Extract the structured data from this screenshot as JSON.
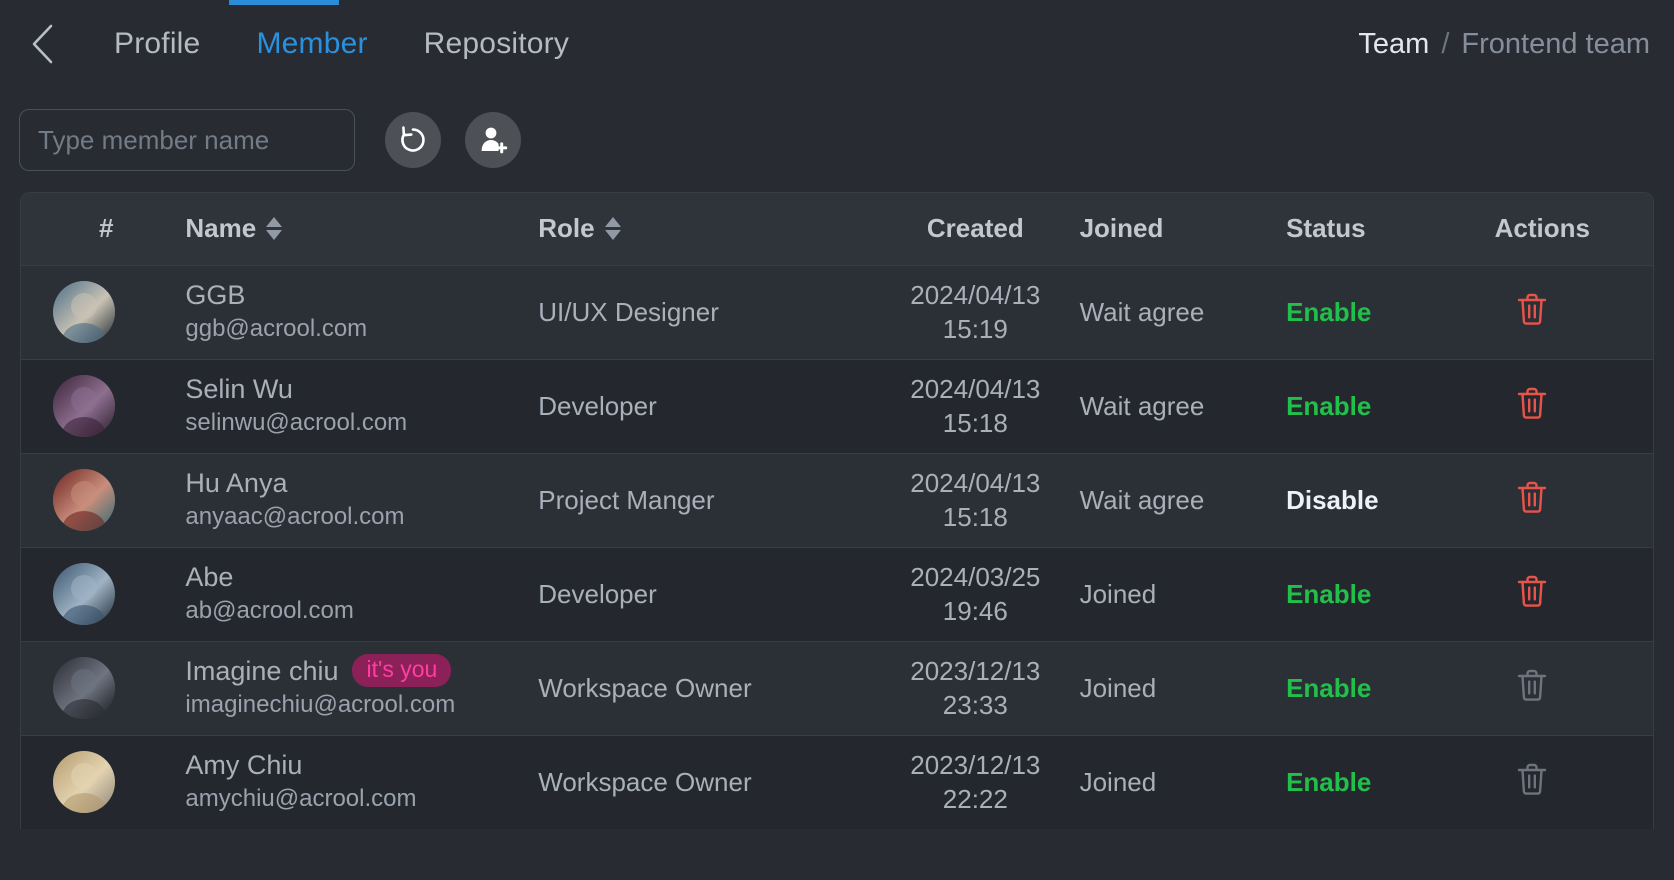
{
  "topbar": {
    "back_icon": "chevron-left-icon",
    "tabs": [
      {
        "label": "Profile",
        "active": false
      },
      {
        "label": "Member",
        "active": true
      },
      {
        "label": "Repository",
        "active": false
      }
    ],
    "breadcrumb": {
      "root": "Team",
      "separator": "/",
      "leaf": "Frontend team"
    }
  },
  "toolbar": {
    "search": {
      "value": "",
      "placeholder": "Type member name",
      "icon": "search-input"
    },
    "refresh_button": {
      "icon": "refresh-icon",
      "label": "Refresh"
    },
    "add_member_button": {
      "icon": "add-user-icon",
      "label": "Add member"
    }
  },
  "table": {
    "columns": [
      {
        "key": "index",
        "label": "#",
        "sortable": false
      },
      {
        "key": "name",
        "label": "Name",
        "sortable": true
      },
      {
        "key": "role",
        "label": "Role",
        "sortable": true
      },
      {
        "key": "created",
        "label": "Created",
        "sortable": false
      },
      {
        "key": "joined",
        "label": "Joined",
        "sortable": false
      },
      {
        "key": "status",
        "label": "Status",
        "sortable": false
      },
      {
        "key": "actions",
        "label": "Actions",
        "sortable": false
      }
    ],
    "rows": [
      {
        "name": "GGB",
        "email": "ggb@acrool.com",
        "badge": "",
        "role": "UI/UX Designer",
        "created_date": "2024/04/13",
        "created_time": "15:19",
        "joined": "Wait agree",
        "status": "Enable",
        "status_kind": "enable",
        "delete_enabled": true
      },
      {
        "name": "Selin Wu",
        "email": "selinwu@acrool.com",
        "badge": "",
        "role": "Developer",
        "created_date": "2024/04/13",
        "created_time": "15:18",
        "joined": "Wait agree",
        "status": "Enable",
        "status_kind": "enable",
        "delete_enabled": true
      },
      {
        "name": "Hu Anya",
        "email": "anyaac@acrool.com",
        "badge": "",
        "role": "Project Manger",
        "created_date": "2024/04/13",
        "created_time": "15:18",
        "joined": "Wait agree",
        "status": "Disable",
        "status_kind": "disable",
        "delete_enabled": true
      },
      {
        "name": "Abe",
        "email": "ab@acrool.com",
        "badge": "",
        "role": "Developer",
        "created_date": "2024/03/25",
        "created_time": "19:46",
        "joined": "Joined",
        "status": "Enable",
        "status_kind": "enable",
        "delete_enabled": true
      },
      {
        "name": "Imagine chiu",
        "email": "imaginechiu@acrool.com",
        "badge": "it's you",
        "role": "Workspace Owner",
        "created_date": "2023/12/13",
        "created_time": "23:33",
        "joined": "Joined",
        "status": "Enable",
        "status_kind": "enable",
        "delete_enabled": false
      },
      {
        "name": "Amy Chiu",
        "email": "amychiu@acrool.com",
        "badge": "",
        "role": "Workspace Owner",
        "created_date": "2023/12/13",
        "created_time": "22:22",
        "joined": "Joined",
        "status": "Enable",
        "status_kind": "enable",
        "delete_enabled": false
      }
    ]
  },
  "colors": {
    "page_bg": "#282c32",
    "row_odd": "#2b3036",
    "row_even": "#24282e",
    "header_bg": "#2f343b",
    "accent_blue": "#2a8ed6",
    "status_enable": "#21c04a",
    "status_disable": "#eef1f5",
    "delete_active": "#e8544a",
    "delete_disabled": "#6d747e",
    "badge_bg": "#8c2159",
    "badge_text": "#ff3ea0"
  }
}
